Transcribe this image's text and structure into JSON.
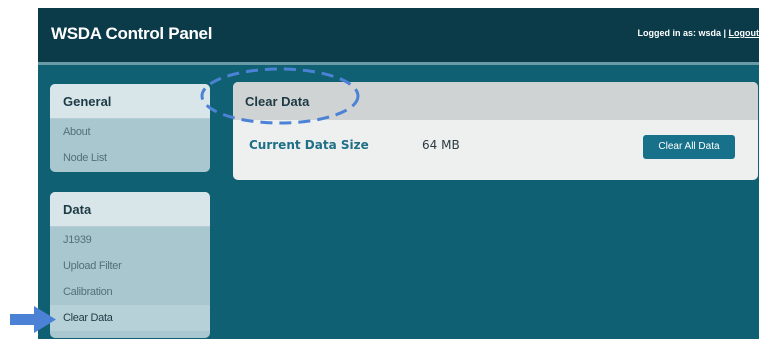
{
  "header": {
    "title": "WSDA Control Panel",
    "logged_in_text": "Logged in as: wsda | ",
    "logout_label": "Logout"
  },
  "sidebar": {
    "sections": [
      {
        "title": "General",
        "items": [
          {
            "label": "About"
          },
          {
            "label": "Node List"
          }
        ]
      },
      {
        "title": "Data",
        "items": [
          {
            "label": "J1939"
          },
          {
            "label": "Upload Filter"
          },
          {
            "label": "Calibration"
          },
          {
            "label": "Clear Data",
            "active": true
          }
        ]
      }
    ]
  },
  "main": {
    "title": "Clear Data",
    "data_size_label": "Current Data Size",
    "data_size_value": "64 MB",
    "clear_button_label": "Clear All Data"
  },
  "annotations": {
    "highlight_color": "#4c82d6"
  }
}
